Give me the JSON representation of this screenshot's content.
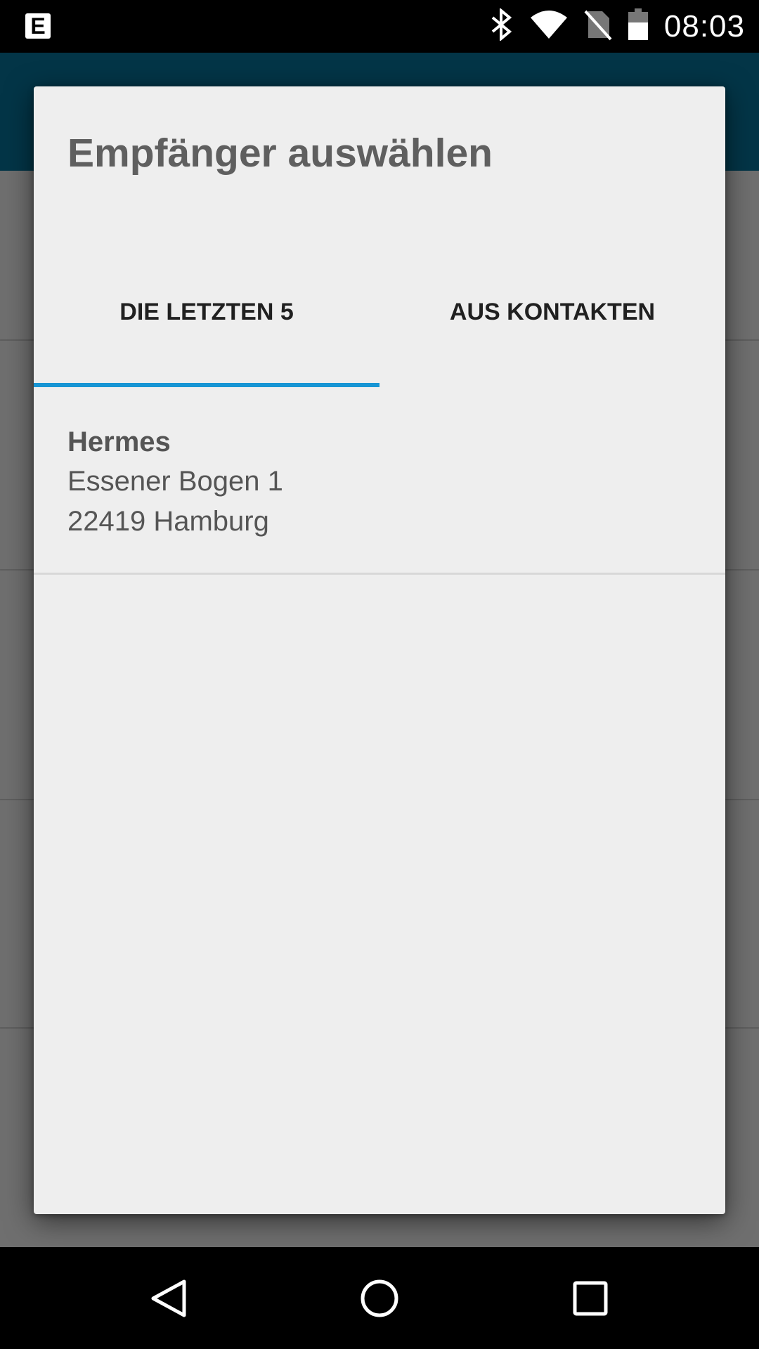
{
  "status_bar": {
    "app_icon_letter": "E",
    "time": "08:03",
    "icons": [
      "bluetooth-icon",
      "wifi-icon",
      "no-sim-icon",
      "battery-icon"
    ]
  },
  "dialog": {
    "title": "Empfänger auswählen",
    "tabs": [
      {
        "label": "DIE LETZTEN 5",
        "selected": true
      },
      {
        "label": "AUS KONTAKTEN",
        "selected": false
      }
    ],
    "recipients": [
      {
        "name": "Hermes",
        "street": "Essener Bogen 1",
        "city": "22419 Hamburg"
      }
    ]
  },
  "colors": {
    "app_bar": "#033547",
    "tab_indicator": "#1795d4",
    "dialog_background": "#eeeeee"
  },
  "nav_bar": {
    "buttons": [
      "back-icon",
      "home-icon",
      "recents-icon"
    ]
  }
}
